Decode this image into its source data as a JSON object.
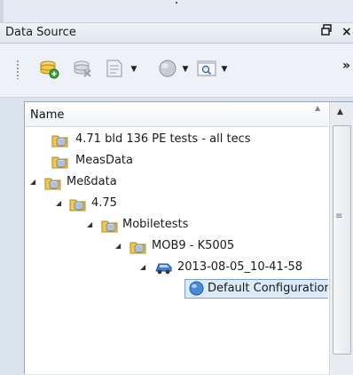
{
  "panel": {
    "title": "Data Source",
    "pin_glyph": "ё",
    "close_glyph": "×"
  },
  "toolbar": {
    "buttons": [
      {
        "icon": "add-datasource-icon"
      },
      {
        "icon": "remove-datasource-icon"
      },
      {
        "icon": "document-icon",
        "has_dropdown": true
      },
      {
        "icon": "sphere-icon",
        "has_dropdown": true
      },
      {
        "icon": "preview-window-icon",
        "has_dropdown": true
      }
    ],
    "dropdown_glyph": "▼",
    "more_glyph": "»"
  },
  "tree": {
    "column_header": "Name",
    "rows": [
      {
        "label": "4.71 bld 136 PE tests - all tecs",
        "icon": "database-folder-icon",
        "expanded": false
      },
      {
        "label": "MeasData",
        "icon": "database-folder-icon",
        "expanded": false
      },
      {
        "label": "Meßdata",
        "icon": "database-folder-icon",
        "expanded": true
      },
      {
        "label": "4.75",
        "icon": "database-folder-icon",
        "expanded": true
      },
      {
        "label": "Mobiletests",
        "icon": "database-folder-icon",
        "expanded": true
      },
      {
        "label": "MOB9 - K5005",
        "icon": "database-folder-icon",
        "expanded": true
      },
      {
        "label": "2013-08-05_10-41-58",
        "icon": "vehicle-icon",
        "expanded": true
      },
      {
        "label": "Default Configuration",
        "icon": "configuration-sphere-icon",
        "expanded": false,
        "selected": true
      }
    ],
    "expand_glyph": "◢"
  },
  "colors": {
    "selection": "#dceaf8",
    "selection_border": "#7aa2d1",
    "folder_yellow": "#f2c94c",
    "globe_blue": "#4c8ad8"
  }
}
